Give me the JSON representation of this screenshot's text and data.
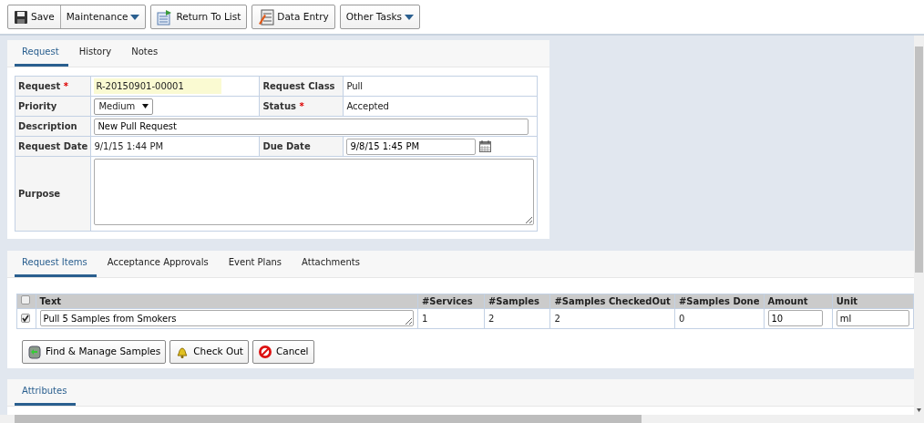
{
  "toolbar": [
    {
      "buttons": [
        {
          "label": "Save",
          "kind": "icon"
        },
        {
          "label": "Maintenance",
          "kind": "menu"
        }
      ]
    },
    {
      "buttons": [
        {
          "label": "Return To List",
          "kind": "icon"
        }
      ]
    },
    {
      "buttons": [
        {
          "label": "Data Entry",
          "kind": "icon"
        }
      ]
    },
    {
      "buttons": [
        {
          "label": "Other Tasks",
          "kind": "menu"
        }
      ]
    }
  ],
  "request_panel": {
    "tabs": [
      {
        "label": "Request",
        "selected": true
      },
      {
        "label": "History",
        "selected": false
      },
      {
        "label": "Notes",
        "selected": false
      }
    ],
    "rows": [
      [
        {
          "label": "Request",
          "required_mark": "*",
          "value": "R-20150901-00001",
          "kind": "highlight"
        },
        {
          "label": "Request Class",
          "value": "Pull",
          "kind": "text"
        }
      ],
      [
        {
          "label": "Priority",
          "value": "Medium",
          "kind": "select"
        },
        {
          "label": "Status",
          "required_mark": "*",
          "value": "Accepted",
          "kind": "text"
        }
      ],
      [
        {
          "label": "Description",
          "value": "New Pull Request",
          "kind": "input"
        }
      ],
      [
        {
          "label": "Request Date",
          "value": "9/1/15 1:44 PM",
          "kind": "text"
        },
        {
          "label": "Due Date",
          "value": "9/8/15 1:45 PM",
          "kind": "date"
        }
      ],
      [
        {
          "label": "Purpose",
          "kind": "textarea"
        }
      ]
    ]
  },
  "items_panel": {
    "tabs": [
      {
        "label": "Request Items",
        "selected": true
      },
      {
        "label": "Acceptance Approvals",
        "selected": false
      },
      {
        "label": "Event Plans",
        "selected": false
      },
      {
        "label": "Attachments",
        "selected": false
      }
    ],
    "header_checked": false,
    "columns": [
      {
        "label": "Text",
        "kind": "textarea"
      },
      {
        "label": "#Services",
        "kind": "text"
      },
      {
        "label": "#Samples",
        "kind": "text"
      },
      {
        "label": "#Samples CheckedOut",
        "kind": "text"
      },
      {
        "label": "#Samples Done",
        "kind": "text"
      },
      {
        "label": "Amount",
        "kind": "input"
      },
      {
        "label": "Unit",
        "kind": "input"
      }
    ],
    "rows": [
      {
        "checked": true,
        "cells": [
          "Pull 5 Samples from Smokers",
          "1",
          "2",
          "2",
          "0",
          "10",
          "ml"
        ]
      }
    ],
    "buttons": [
      "Find & Manage Samples",
      "Check Out",
      "Cancel"
    ]
  },
  "attributes_panel": {
    "tabs": [
      {
        "label": "Attributes",
        "selected": true
      }
    ]
  }
}
